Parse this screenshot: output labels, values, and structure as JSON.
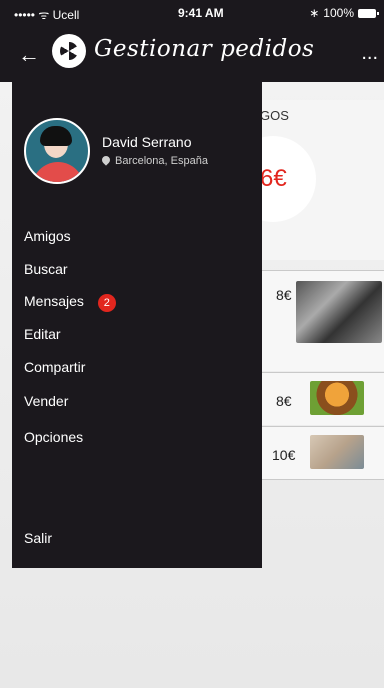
{
  "status_bar": {
    "carrier": "••••• ᯤ Ucell",
    "time": "9:41 AM",
    "battery": "100%"
  },
  "nav": {
    "back": "←",
    "title": "Gestionar pedidos",
    "more": "..."
  },
  "background": {
    "section_label": "GOS",
    "amount": "6€",
    "items": [
      {
        "price": "8€"
      },
      {
        "price": "8€"
      },
      {
        "price": "10€"
      }
    ]
  },
  "drawer": {
    "user": {
      "name": "David Serrano",
      "location": "Barcelona, España"
    },
    "menu": [
      {
        "label": "Amigos"
      },
      {
        "label": "Buscar"
      },
      {
        "label": "Mensajes",
        "badge": "2"
      },
      {
        "label": "Editar"
      },
      {
        "label": "Compartir"
      },
      {
        "label": "Vender"
      },
      {
        "label": "Opciones"
      }
    ],
    "exit": "Salir"
  },
  "colors": {
    "dark": "#1b181d",
    "accent_red": "#e2261e"
  }
}
